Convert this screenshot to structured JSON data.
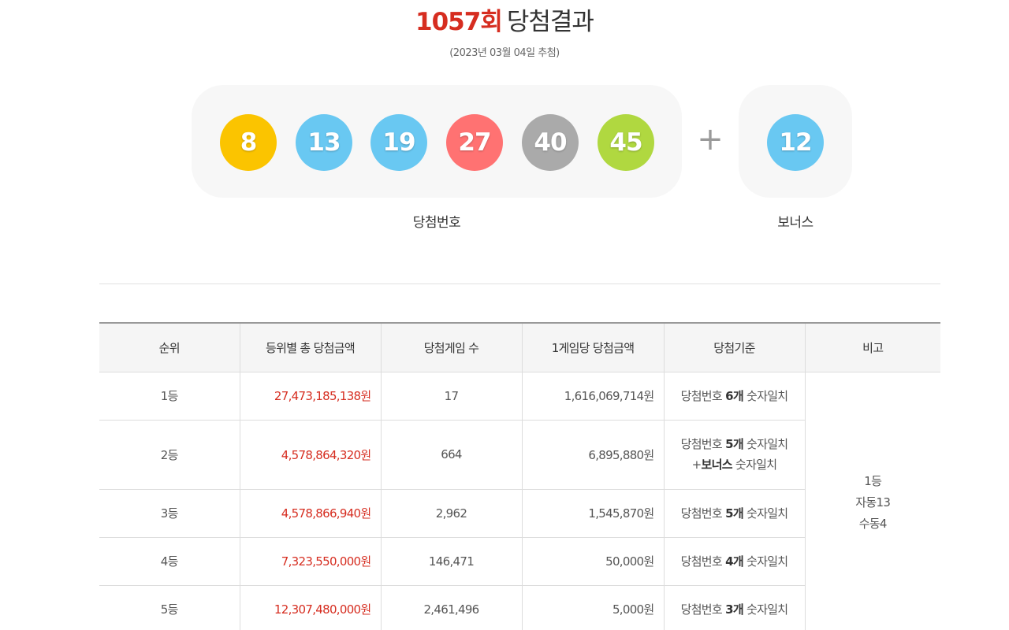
{
  "header": {
    "round": "1057회",
    "title_rest": "당첨결과",
    "draw_date": "(2023년 03월 04일 추첨)"
  },
  "winning": {
    "caption": "당첨번호",
    "balls": [
      {
        "number": "8",
        "color": "#fbc400"
      },
      {
        "number": "13",
        "color": "#69c8f2"
      },
      {
        "number": "19",
        "color": "#69c8f2"
      },
      {
        "number": "27",
        "color": "#ff7272"
      },
      {
        "number": "40",
        "color": "#aaaaaa"
      },
      {
        "number": "45",
        "color": "#b0d840"
      }
    ],
    "plus_symbol": "+"
  },
  "bonus": {
    "caption": "보너스",
    "number": "12",
    "color": "#69c8f2"
  },
  "table": {
    "headers": [
      "순위",
      "등위별 총 당첨금액",
      "당첨게임 수",
      "1게임당 당첨금액",
      "당첨기준",
      "비고"
    ],
    "rows": [
      {
        "rank": "1등",
        "total": "27,473,185,138원",
        "games": "17",
        "per_game": "1,616,069,714원",
        "criteria_pre": "당첨번호 ",
        "criteria_bold": "6개",
        "criteria_post": " 숫자일치"
      },
      {
        "rank": "2등",
        "total": "4,578,864,320원",
        "games": "664",
        "per_game": "6,895,880원",
        "criteria_pre": "당첨번호 ",
        "criteria_bold": "5개",
        "criteria_post": " 숫자일치",
        "criteria2_pre": "+",
        "criteria2_bold": "보너스",
        "criteria2_post": " 숫자일치"
      },
      {
        "rank": "3등",
        "total": "4,578,866,940원",
        "games": "2,962",
        "per_game": "1,545,870원",
        "criteria_pre": "당첨번호 ",
        "criteria_bold": "5개",
        "criteria_post": " 숫자일치"
      },
      {
        "rank": "4등",
        "total": "7,323,550,000원",
        "games": "146,471",
        "per_game": "50,000원",
        "criteria_pre": "당첨번호 ",
        "criteria_bold": "4개",
        "criteria_post": " 숫자일치"
      },
      {
        "rank": "5등",
        "total": "12,307,480,000원",
        "games": "2,461,496",
        "per_game": "5,000원",
        "criteria_pre": "당첨번호 ",
        "criteria_bold": "3개",
        "criteria_post": " 숫자일치"
      }
    ],
    "note": {
      "line1": "1등",
      "line2": "자동13",
      "line3": "수동4"
    }
  }
}
